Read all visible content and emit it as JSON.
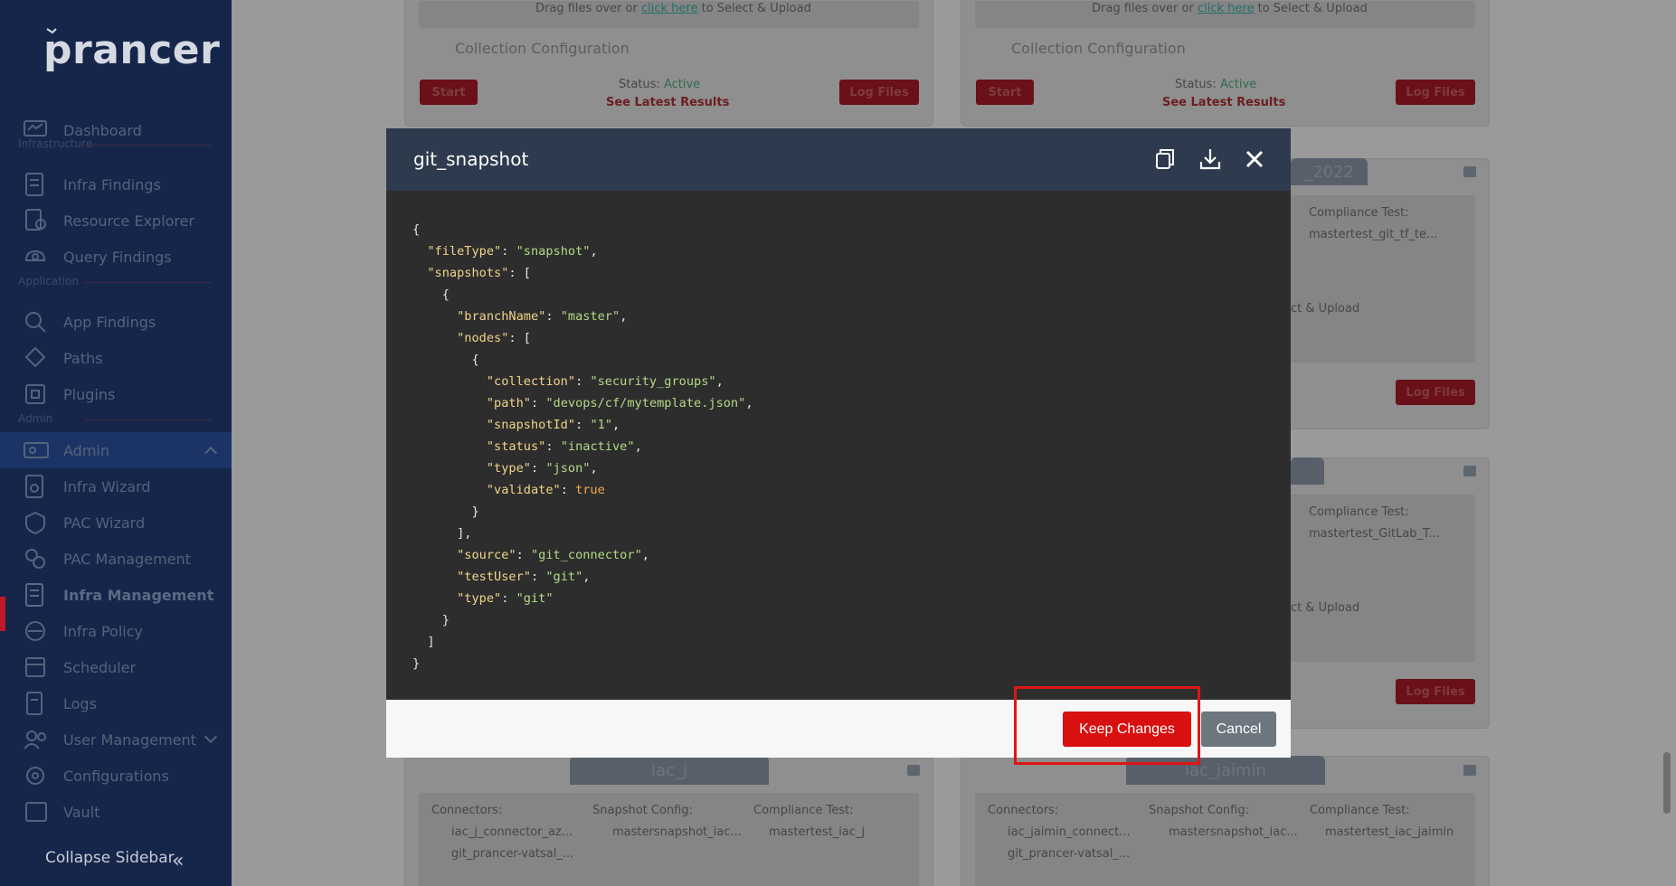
{
  "sidebar": {
    "logo": "prancer",
    "sections": {
      "infrastructure": "Infrastructure",
      "application": "Application",
      "admin": "Admin"
    },
    "items": [
      {
        "label": "Dashboard",
        "icon": "dashboard-icon"
      },
      {
        "label": "Infra Findings",
        "icon": "infra-findings-icon"
      },
      {
        "label": "Resource Explorer",
        "icon": "resource-explorer-icon"
      },
      {
        "label": "Query Findings",
        "icon": "query-findings-icon"
      },
      {
        "label": "App Findings",
        "icon": "app-findings-icon"
      },
      {
        "label": "Paths",
        "icon": "paths-icon"
      },
      {
        "label": "Plugins",
        "icon": "plugins-icon"
      },
      {
        "label": "Admin",
        "icon": "admin-icon"
      },
      {
        "label": "Infra Wizard",
        "icon": "infra-wizard-icon"
      },
      {
        "label": "PAC Wizard",
        "icon": "pac-wizard-icon"
      },
      {
        "label": "PAC Management",
        "icon": "pac-management-icon"
      },
      {
        "label": "Infra Management",
        "icon": "infra-management-icon"
      },
      {
        "label": "Infra Policy",
        "icon": "infra-policy-icon"
      },
      {
        "label": "Scheduler",
        "icon": "scheduler-icon"
      },
      {
        "label": "Logs",
        "icon": "logs-icon"
      },
      {
        "label": "User Management",
        "icon": "user-management-icon"
      },
      {
        "label": "Configurations",
        "icon": "configurations-icon"
      },
      {
        "label": "Vault",
        "icon": "vault-icon"
      }
    ],
    "collapse_label": "Collapse Sidebar"
  },
  "background": {
    "drag_prefix": "Drag files over or",
    "drag_link": "click here",
    "drag_suffix": "to Select & Upload",
    "collection_config": "Collection Configuration",
    "start": "Start",
    "log_files": "Log Files",
    "status_label": "Status:",
    "status_value": "Active",
    "see_results": "See Latest Results",
    "tab_2022": "_2022",
    "tab_iac_j": "iac_j",
    "tab_iac_jaimin": "iac_jaimin",
    "compliance_test": "Compliance Test:",
    "compliance_1": "mastertest_git_tf_te...",
    "compliance_2": "mastertest_GitLab_T...",
    "select_upload_partial": "ct & Upload",
    "connectors": "Connectors:",
    "snapshot_config": "Snapshot Config:",
    "iac_j_connector": "iac_j_connector_az...",
    "iac_j_git": "git_prancer-vatsal_...",
    "iac_j_snapshot": "mastersnapshot_iac...",
    "iac_j_compliance": "mastertest_iac_j",
    "jaimin_connector": "iac_jaimin_connect...",
    "jaimin_git": "git_prancer-vatsal_...",
    "jaimin_snapshot": "mastersnapshot_iac...",
    "jaimin_compliance": "mastertest_iac_jaimin"
  },
  "modal": {
    "title": "git_snapshot",
    "json": {
      "fileType": "snapshot",
      "branchName": "master",
      "collection": "security_groups",
      "path": "devops/cf/mytemplate.json",
      "snapshotId": "1",
      "status": "inactive",
      "type_json": "json",
      "validate": "true",
      "source": "git_connector",
      "testUser": "git",
      "type_git": "git"
    },
    "keep_label": "Keep Changes",
    "cancel_label": "Cancel"
  },
  "colors": {
    "sidebar_bg": "#16264a",
    "modal_header": "#2e3a4e",
    "code_bg": "#2d2d2d",
    "accent_red": "#d81010",
    "cancel_gray": "#6e7680"
  }
}
